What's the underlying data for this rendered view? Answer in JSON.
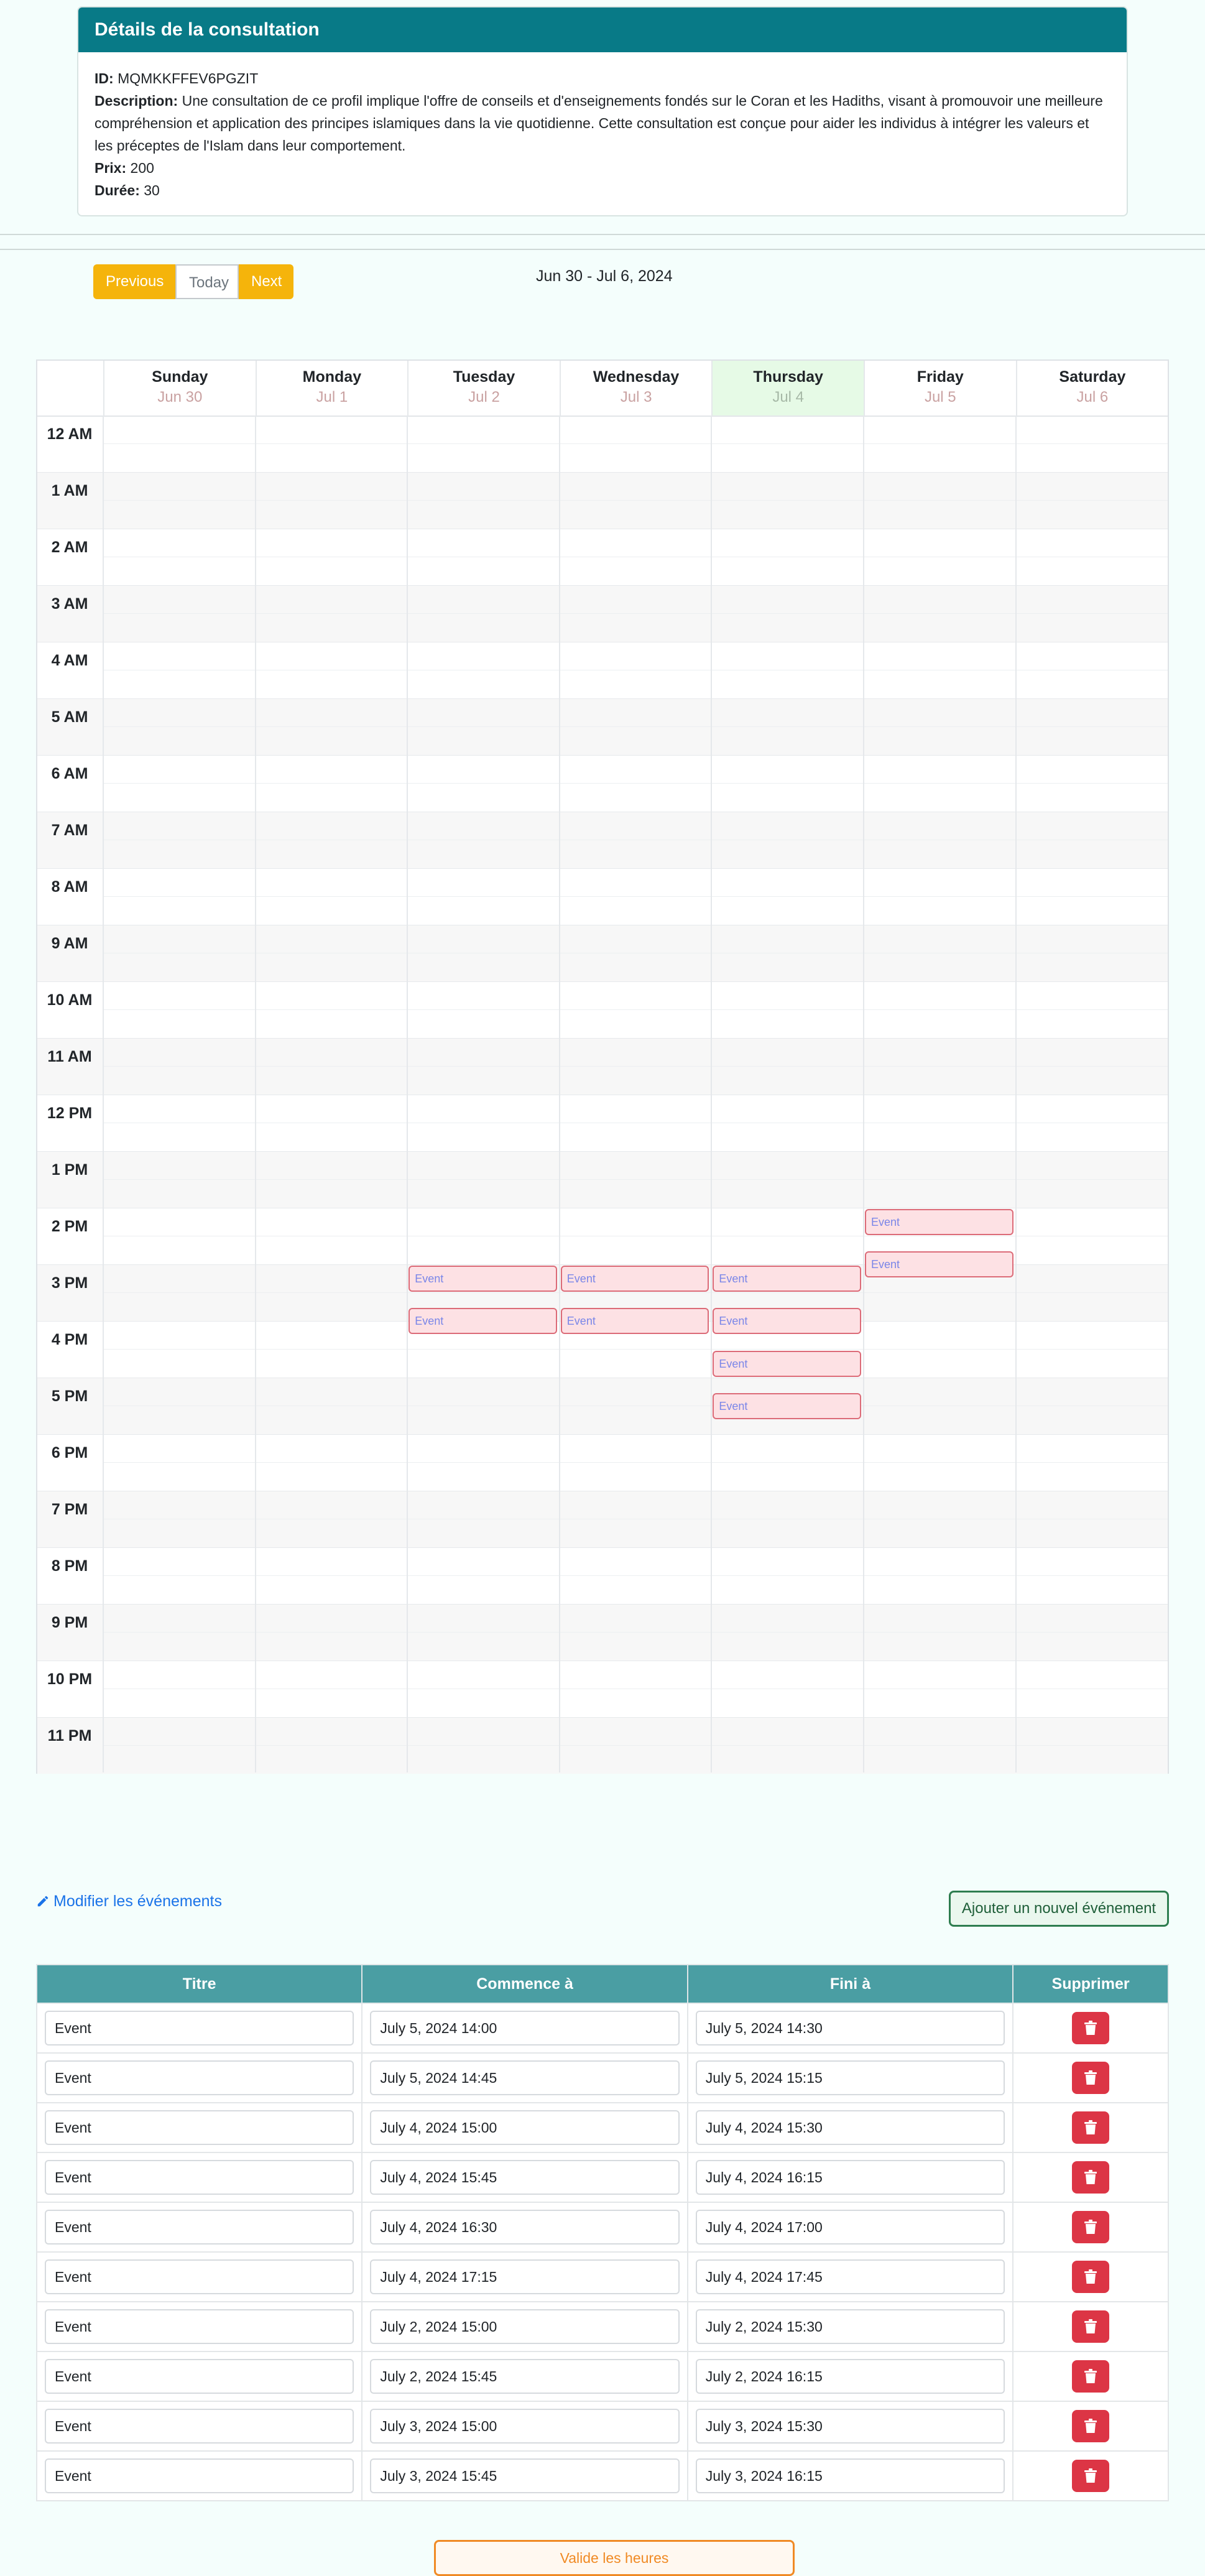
{
  "details": {
    "title": "Détails de la consultation",
    "id_label": "ID:",
    "id_value": "MQMKKFFEV6PGZIT",
    "description_label": "Description:",
    "description_value": "Une consultation de ce profil implique l'offre de conseils et d'enseignements fondés sur le Coran et les Hadiths, visant à promouvoir une meilleure compréhension et application des principes islamiques dans la vie quotidienne. Cette consultation est conçue pour aider les individus à intégrer les valeurs et les préceptes de l'Islam dans leur comportement.",
    "price_label": "Prix:",
    "price_value": "200",
    "duration_label": "Durée:",
    "duration_value": "30"
  },
  "toolbar": {
    "previous": "Previous",
    "today": "Today",
    "next": "Next",
    "range": "Jun 30 - Jul 6, 2024"
  },
  "calendar": {
    "days": [
      {
        "name": "Sunday",
        "date": "Jun 30"
      },
      {
        "name": "Monday",
        "date": "Jul 1"
      },
      {
        "name": "Tuesday",
        "date": "Jul 2"
      },
      {
        "name": "Wednesday",
        "date": "Jul 3"
      },
      {
        "name": "Thursday",
        "date": "Jul 4",
        "today": true
      },
      {
        "name": "Friday",
        "date": "Jul 5"
      },
      {
        "name": "Saturday",
        "date": "Jul 6"
      }
    ],
    "hours": [
      "12 AM",
      "1 AM",
      "2 AM",
      "3 AM",
      "4 AM",
      "5 AM",
      "6 AM",
      "7 AM",
      "8 AM",
      "9 AM",
      "10 AM",
      "11 AM",
      "12 PM",
      "1 PM",
      "2 PM",
      "3 PM",
      "4 PM",
      "5 PM",
      "6 PM",
      "7 PM",
      "8 PM",
      "9 PM",
      "10 PM",
      "11 PM"
    ],
    "events": [
      {
        "title": "Event",
        "day": 5,
        "start": "14:00",
        "end": "14:30"
      },
      {
        "title": "Event",
        "day": 5,
        "start": "14:45",
        "end": "15:15"
      },
      {
        "title": "Event",
        "day": 4,
        "start": "15:00",
        "end": "15:30"
      },
      {
        "title": "Event",
        "day": 4,
        "start": "15:45",
        "end": "16:15"
      },
      {
        "title": "Event",
        "day": 4,
        "start": "16:30",
        "end": "17:00"
      },
      {
        "title": "Event",
        "day": 4,
        "start": "17:15",
        "end": "17:45"
      },
      {
        "title": "Event",
        "day": 2,
        "start": "15:00",
        "end": "15:30"
      },
      {
        "title": "Event",
        "day": 2,
        "start": "15:45",
        "end": "16:15"
      },
      {
        "title": "Event",
        "day": 3,
        "start": "15:00",
        "end": "15:30"
      },
      {
        "title": "Event",
        "day": 3,
        "start": "15:45",
        "end": "16:15"
      }
    ]
  },
  "edit": {
    "edit_link": "Modifier les événements",
    "add_button": "Ajouter un nouvel événement",
    "columns": [
      "Titre",
      "Commence à",
      "Fini à",
      "Supprimer"
    ],
    "rows": [
      {
        "title": "Event",
        "start": "July 5, 2024 14:00",
        "end": "July 5, 2024 14:30"
      },
      {
        "title": "Event",
        "start": "July 5, 2024 14:45",
        "end": "July 5, 2024 15:15"
      },
      {
        "title": "Event",
        "start": "July 4, 2024 15:00",
        "end": "July 4, 2024 15:30"
      },
      {
        "title": "Event",
        "start": "July 4, 2024 15:45",
        "end": "July 4, 2024 16:15"
      },
      {
        "title": "Event",
        "start": "July 4, 2024 16:30",
        "end": "July 4, 2024 17:00"
      },
      {
        "title": "Event",
        "start": "July 4, 2024 17:15",
        "end": "July 4, 2024 17:45"
      },
      {
        "title": "Event",
        "start": "July 2, 2024 15:00",
        "end": "July 2, 2024 15:30"
      },
      {
        "title": "Event",
        "start": "July 2, 2024 15:45",
        "end": "July 2, 2024 16:15"
      },
      {
        "title": "Event",
        "start": "July 3, 2024 15:00",
        "end": "July 3, 2024 15:30"
      },
      {
        "title": "Event",
        "start": "July 3, 2024 15:45",
        "end": "July 3, 2024 16:15"
      }
    ],
    "validate_button": "Valide les heures"
  },
  "colors": {
    "header_teal": "#087a87",
    "accent_yellow": "#f5b40b",
    "event_bg": "#fde1e4",
    "event_border": "#dc6b78",
    "delete_red": "#dc3545",
    "validate_orange": "#f08a24"
  }
}
